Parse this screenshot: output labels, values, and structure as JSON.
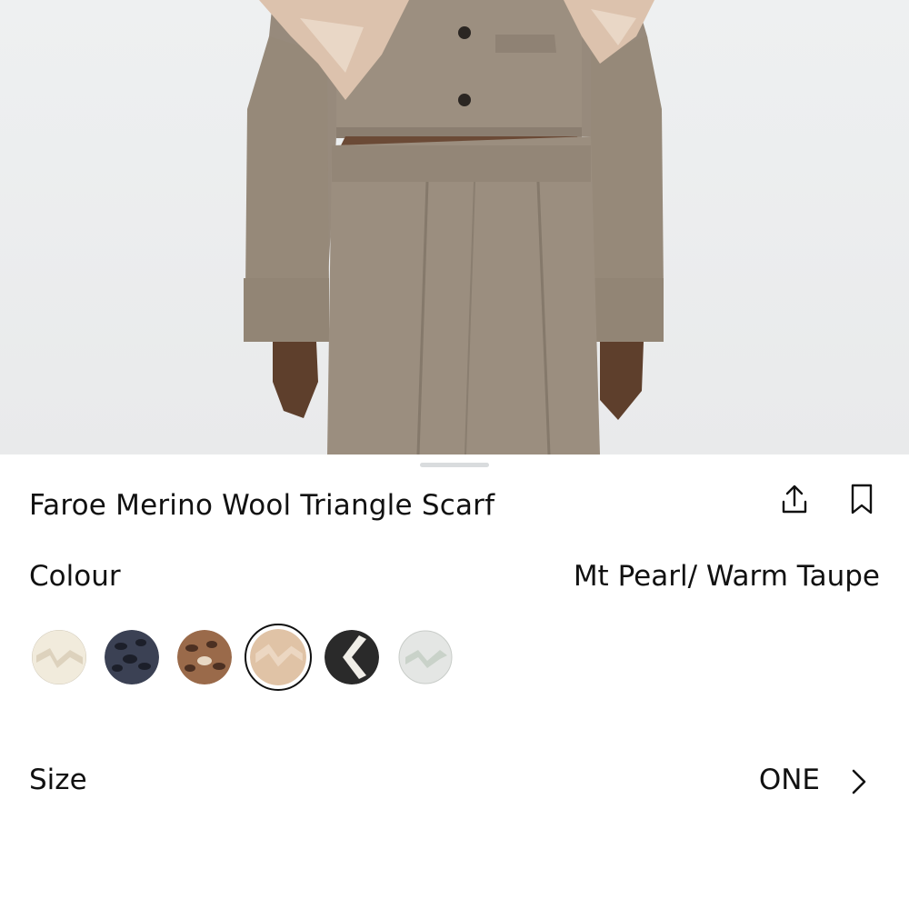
{
  "hero": {
    "image_icon": "product-photo"
  },
  "product": {
    "title": "Faroe Merino Wool Triangle Scarf",
    "share_icon": "share-icon",
    "bookmark_icon": "bookmark-icon"
  },
  "colour": {
    "label": "Colour",
    "selected_value": "Mt Pearl/ Warm Taupe",
    "swatches": [
      {
        "base": "#f1ebdc",
        "pattern": "#ddd2bd",
        "selected": false
      },
      {
        "base": "#3b4154",
        "pattern": "#1c1f2a",
        "selected": false
      },
      {
        "base": "#9a6a4a",
        "pattern": "#4c3022",
        "selected": false
      },
      {
        "base": "#e0c3a6",
        "pattern": "#ecd7c2",
        "selected": true
      },
      {
        "base": "#2a2a2a",
        "pattern": "#f0eee8",
        "selected": false
      },
      {
        "base": "#e4e6e4",
        "pattern": "#c9d2c9",
        "selected": false
      }
    ]
  },
  "size": {
    "label": "Size",
    "value": "ONE",
    "chevron_icon": "chevron-right-icon"
  },
  "colors": {
    "text": "#111111",
    "handle": "#d9dcde"
  }
}
